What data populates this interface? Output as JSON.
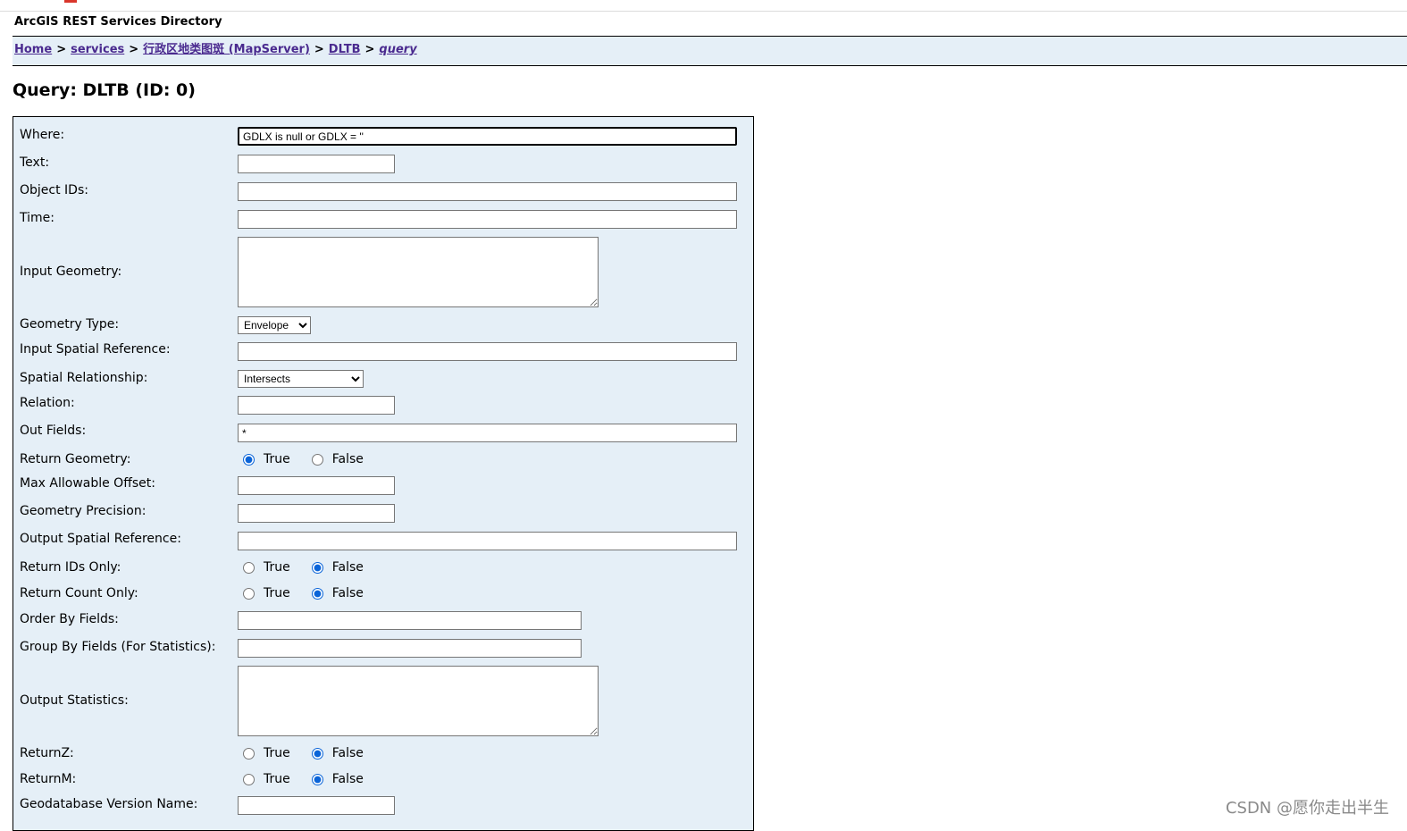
{
  "header": {
    "directory_title": "ArcGIS REST Services Directory"
  },
  "breadcrumb": {
    "items": [
      "Home",
      "services",
      "行政区地类图斑 (MapServer)",
      "DLTB",
      "query"
    ],
    "separator": ">"
  },
  "page": {
    "title": "Query: DLTB (ID: 0)"
  },
  "form": {
    "where": {
      "label": "Where:",
      "value": "GDLX is null or GDLX = ''"
    },
    "text": {
      "label": "Text:",
      "value": ""
    },
    "object_ids": {
      "label": "Object IDs:",
      "value": ""
    },
    "time": {
      "label": "Time:",
      "value": ""
    },
    "input_geometry": {
      "label": "Input Geometry:",
      "value": ""
    },
    "geometry_type": {
      "label": "Geometry Type:",
      "selected": "Envelope"
    },
    "input_spatial_reference": {
      "label": "Input Spatial Reference:",
      "value": ""
    },
    "spatial_relationship": {
      "label": "Spatial Relationship:",
      "selected": "Intersects"
    },
    "relation": {
      "label": "Relation:",
      "value": ""
    },
    "out_fields": {
      "label": "Out Fields:",
      "value": "*"
    },
    "return_geometry": {
      "label": "Return Geometry:",
      "true_label": "True",
      "false_label": "False",
      "selected": "true"
    },
    "max_allowable_offset": {
      "label": "Max Allowable Offset:",
      "value": ""
    },
    "geometry_precision": {
      "label": "Geometry Precision:",
      "value": ""
    },
    "output_spatial_reference": {
      "label": "Output Spatial Reference:",
      "value": ""
    },
    "return_ids_only": {
      "label": "Return IDs Only:",
      "true_label": "True",
      "false_label": "False",
      "selected": "false"
    },
    "return_count_only": {
      "label": "Return Count Only:",
      "true_label": "True",
      "false_label": "False",
      "selected": "false"
    },
    "order_by_fields": {
      "label": "Order By Fields:",
      "value": ""
    },
    "group_by_fields": {
      "label": "Group By Fields (For Statistics):",
      "value": ""
    },
    "output_statistics": {
      "label": "Output Statistics:",
      "value": ""
    },
    "return_z": {
      "label": "ReturnZ:",
      "true_label": "True",
      "false_label": "False",
      "selected": "false"
    },
    "return_m": {
      "label": "ReturnM:",
      "true_label": "True",
      "false_label": "False",
      "selected": "false"
    },
    "gdb_version": {
      "label": "Geodatabase Version Name:",
      "value": ""
    }
  },
  "watermark": {
    "text": "CSDN @愿你走出半生"
  },
  "colors": {
    "panel_bg": "#e5eff7",
    "link": "#4a2a8f",
    "radio_accent": "#0a64d8"
  }
}
